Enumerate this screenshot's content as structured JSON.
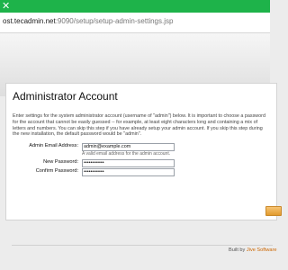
{
  "browser": {
    "close_glyph": "✕",
    "url_host": "ost.tecadmin.net",
    "url_path": ":9090/setup/setup-admin-settings.jsp"
  },
  "panel": {
    "title": "Administrator Account",
    "description": "Enter settings for the system administrator account (username of \"admin\") below. It is important to choose a password for the account that cannot be easily guessed -- for example, at least eight characters long and containing a mix of letters and numbers. You can skip this step if you have already setup your admin account. If you skip this step during the new installation, the default password would be \"admin\"."
  },
  "form": {
    "email_label": "Admin Email Address:",
    "email_value": "admin@example.com",
    "email_help": "A valid email address for the admin account.",
    "password_label": "New Password:",
    "password_value": "••••••••••••",
    "confirm_label": "Confirm Password:",
    "confirm_value": "••••••••••••"
  },
  "footer": {
    "built_by": "Built by ",
    "company": "Jive Software"
  },
  "colors": {
    "topbar": "#1eb34a",
    "button": "#e8a440",
    "link": "#cc6600"
  }
}
